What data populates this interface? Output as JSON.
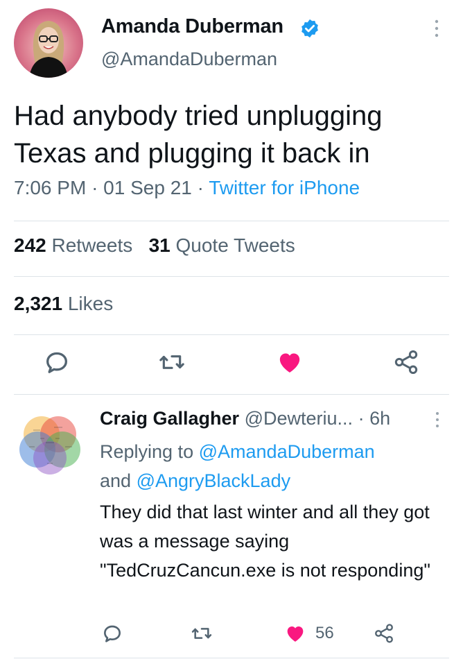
{
  "tweet": {
    "author_name": "Amanda Duberman",
    "author_handle": "@AmandaDuberman",
    "text": "Had anybody tried unplugging Texas and plugging it back in",
    "time": "7:06 PM",
    "date": "01 Sep 21",
    "source": "Twitter for iPhone",
    "retweets_count": "242",
    "retweets_label": "Retweets",
    "quotes_count": "31",
    "quotes_label": "Quote Tweets",
    "likes_count": "2,321",
    "likes_label": "Likes",
    "actions": [
      "reply-icon",
      "retweet-icon",
      "heart-icon",
      "share-icon"
    ]
  },
  "reply": {
    "author_name": "Craig Gallagher",
    "author_handle": "@Dewteriu...",
    "time": "6h",
    "replying_prefix": "Replying to",
    "mention_1": "@AmandaDuberman",
    "conjunction": "and",
    "mention_2": "@AngryBlackLady",
    "text": "They did that last winter and all they got was a message saying \"TedCruzCancun.exe is not responding\"",
    "like_count": "56"
  },
  "colors": {
    "text": "#0f1419",
    "secondary": "#536471",
    "link": "#1d9bf0",
    "like": "#f91880",
    "divider": "#dde3e8"
  }
}
